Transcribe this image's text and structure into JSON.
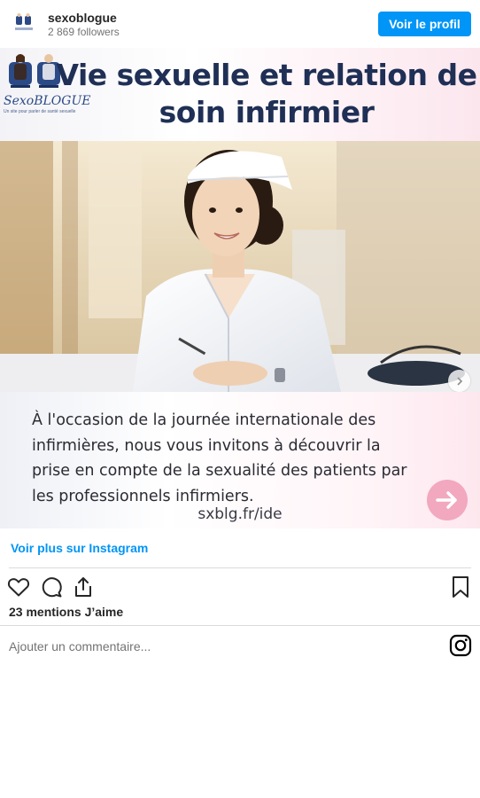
{
  "header": {
    "username": "sexoblogue",
    "followers": "2 869 followers",
    "profile_button": "Voir le profil"
  },
  "post": {
    "banner_title": "Vie sexuelle et relation de soin infirmier",
    "logo": {
      "name": "SexoBLOGUE",
      "tagline": "Un site pour parler de santé sexuelle"
    },
    "caption": "À l'occasion de la journée internationale des infirmières, nous vous invitons à découvrir la prise en compte de la sexualité des patients par les professionnels infirmiers.",
    "caption_link": "sxblg.fr/ide",
    "colors": {
      "banner_title": "#1f2f55",
      "arrow_circle": "#f2a8bf"
    }
  },
  "footer": {
    "see_more": "Voir plus sur Instagram",
    "likes": "23 mentions J’aime",
    "comment_placeholder": "Ajouter un commentaire...",
    "icons": [
      "heart-icon",
      "comment-icon",
      "share-icon",
      "bookmark-icon",
      "instagram-icon"
    ]
  },
  "theme": {
    "accent": "#0095f6",
    "divider": "#dbdbdb"
  }
}
